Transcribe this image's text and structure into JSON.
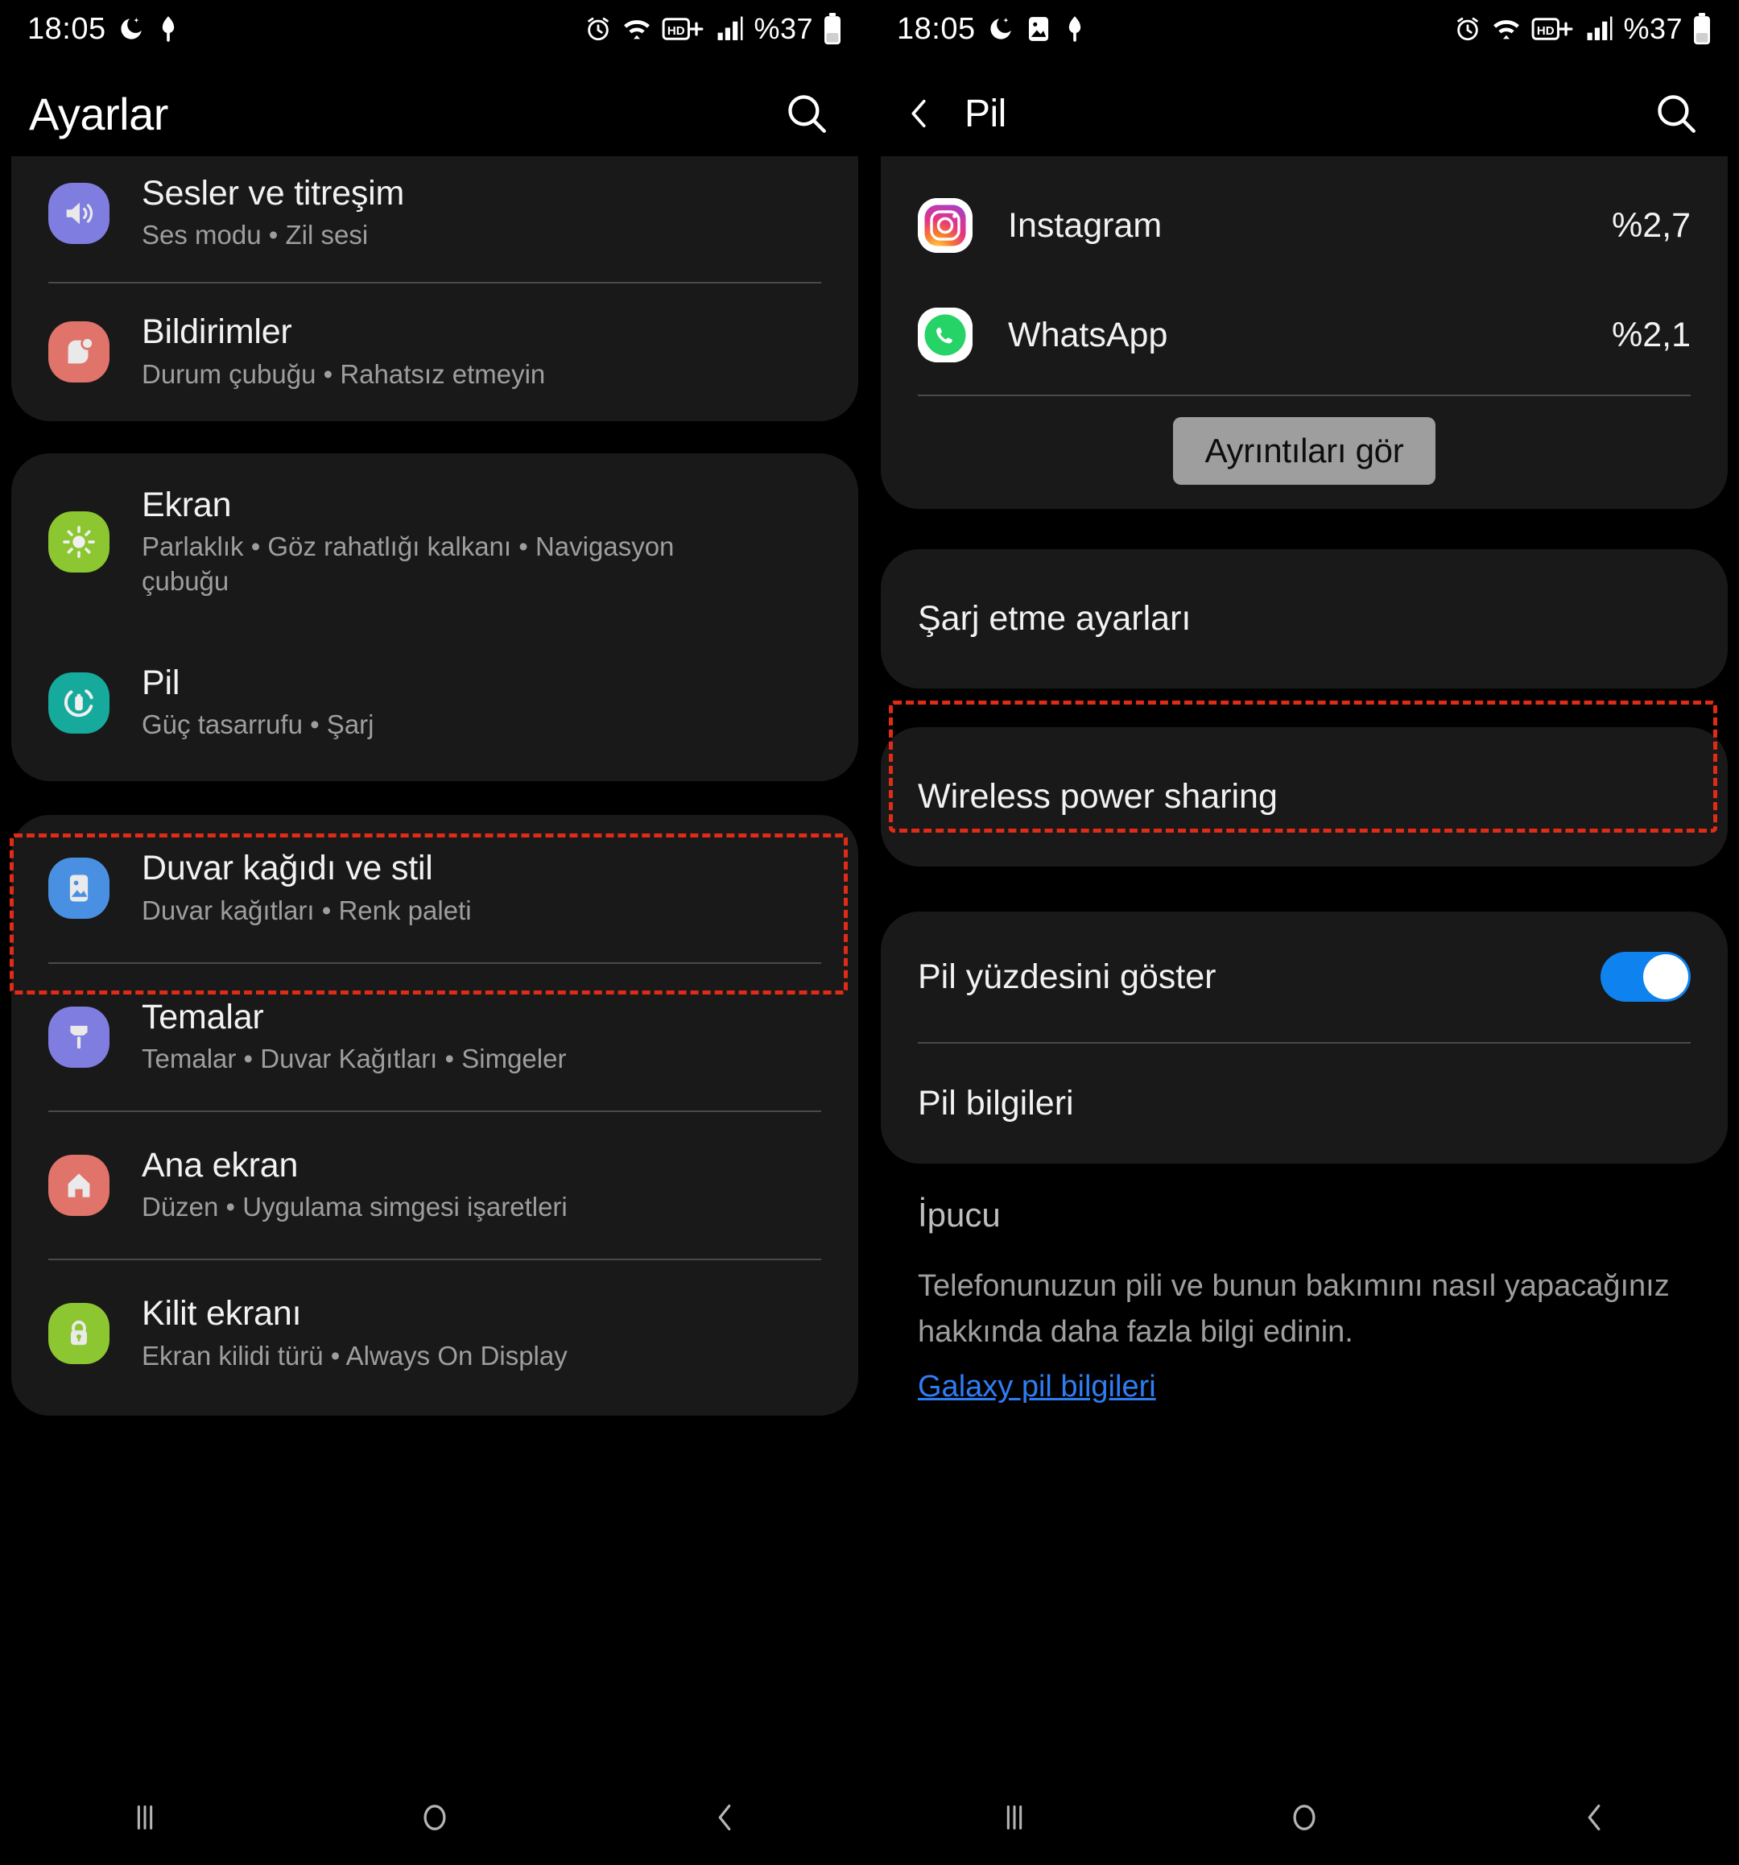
{
  "statusbar": {
    "time": "18:05",
    "battery_percent": "%37",
    "left_icons_panel1": [
      "moon-icon",
      "do-not-disturb-icon"
    ],
    "left_icons_panel2": [
      "moon-icon",
      "image-icon",
      "do-not-disturb-icon"
    ],
    "right_icons": [
      "alarm-icon",
      "wifi-icon",
      "hd-plus-icon",
      "signal-icon"
    ]
  },
  "left_panel": {
    "appbar": {
      "title": "Ayarlar",
      "search_icon": "search-icon"
    },
    "groups": [
      {
        "items": [
          {
            "title": "Sesler ve titreşim",
            "subtitle": "Ses modu  •  Zil sesi",
            "icon": "sound-icon",
            "icon_color": "#7f7de0"
          },
          {
            "title": "Bildirimler",
            "subtitle": "Durum çubuğu  •  Rahatsız etmeyin",
            "icon": "notifications-icon",
            "icon_color": "#e0736a"
          }
        ]
      },
      {
        "items": [
          {
            "title": "Ekran",
            "subtitle": "Parlaklık  •  Göz rahatlığı kalkanı  •  Navigasyon çubuğu",
            "icon": "brightness-icon",
            "icon_color": "#8cc631"
          },
          {
            "title": "Pil",
            "subtitle": "Güç tasarrufu  •  Şarj",
            "icon": "battery-icon",
            "icon_color": "#16aa9c",
            "highlighted": true
          }
        ]
      },
      {
        "items": [
          {
            "title": "Duvar kağıdı ve stil",
            "subtitle": "Duvar kağıtları  •  Renk paleti",
            "icon": "wallpaper-icon",
            "icon_color": "#4a90e2"
          },
          {
            "title": "Temalar",
            "subtitle": "Temalar  •  Duvar Kağıtları  •  Simgeler",
            "icon": "themes-brush-icon",
            "icon_color": "#7f7de0"
          },
          {
            "title": "Ana ekran",
            "subtitle": "Düzen  •  Uygulama simgesi işaretleri",
            "icon": "home-icon",
            "icon_color": "#e0736a"
          },
          {
            "title": "Kilit ekranı",
            "subtitle": "Ekran kilidi türü  •  Always On Display",
            "icon": "lock-icon",
            "icon_color": "#8cc631"
          }
        ]
      }
    ]
  },
  "right_panel": {
    "appbar": {
      "title": "Pil",
      "back_icon": "chevron-left-icon",
      "search_icon": "search-icon"
    },
    "usage_apps": [
      {
        "name": "Instagram",
        "percent": "%2,7",
        "icon": "instagram-icon"
      },
      {
        "name": "WhatsApp",
        "percent": "%2,1",
        "icon": "whatsapp-icon"
      }
    ],
    "details_button": "Ayrıntıları gör",
    "charging_settings": {
      "label": "Şarj etme ayarları",
      "highlighted": true
    },
    "wireless_power_sharing": {
      "label": "Wireless power sharing"
    },
    "show_battery_percent": {
      "label": "Pil yüzdesini göster",
      "toggle_on": true
    },
    "battery_info": {
      "label": "Pil bilgileri"
    },
    "tip": {
      "title": "İpucu",
      "body": "Telefonunuzun pili ve bunun bakımını nasıl yapacağınız hakkında daha fazla bilgi edinin.",
      "link": "Galaxy pil bilgileri"
    }
  },
  "navbar": {
    "recents": "recents-icon",
    "home": "home-circle-icon",
    "back": "back-chevron-icon"
  },
  "colors": {
    "accent_toggle": "#0e82ee",
    "link": "#2f7df4",
    "highlight": "#e02b16",
    "card_bg": "#191919"
  }
}
